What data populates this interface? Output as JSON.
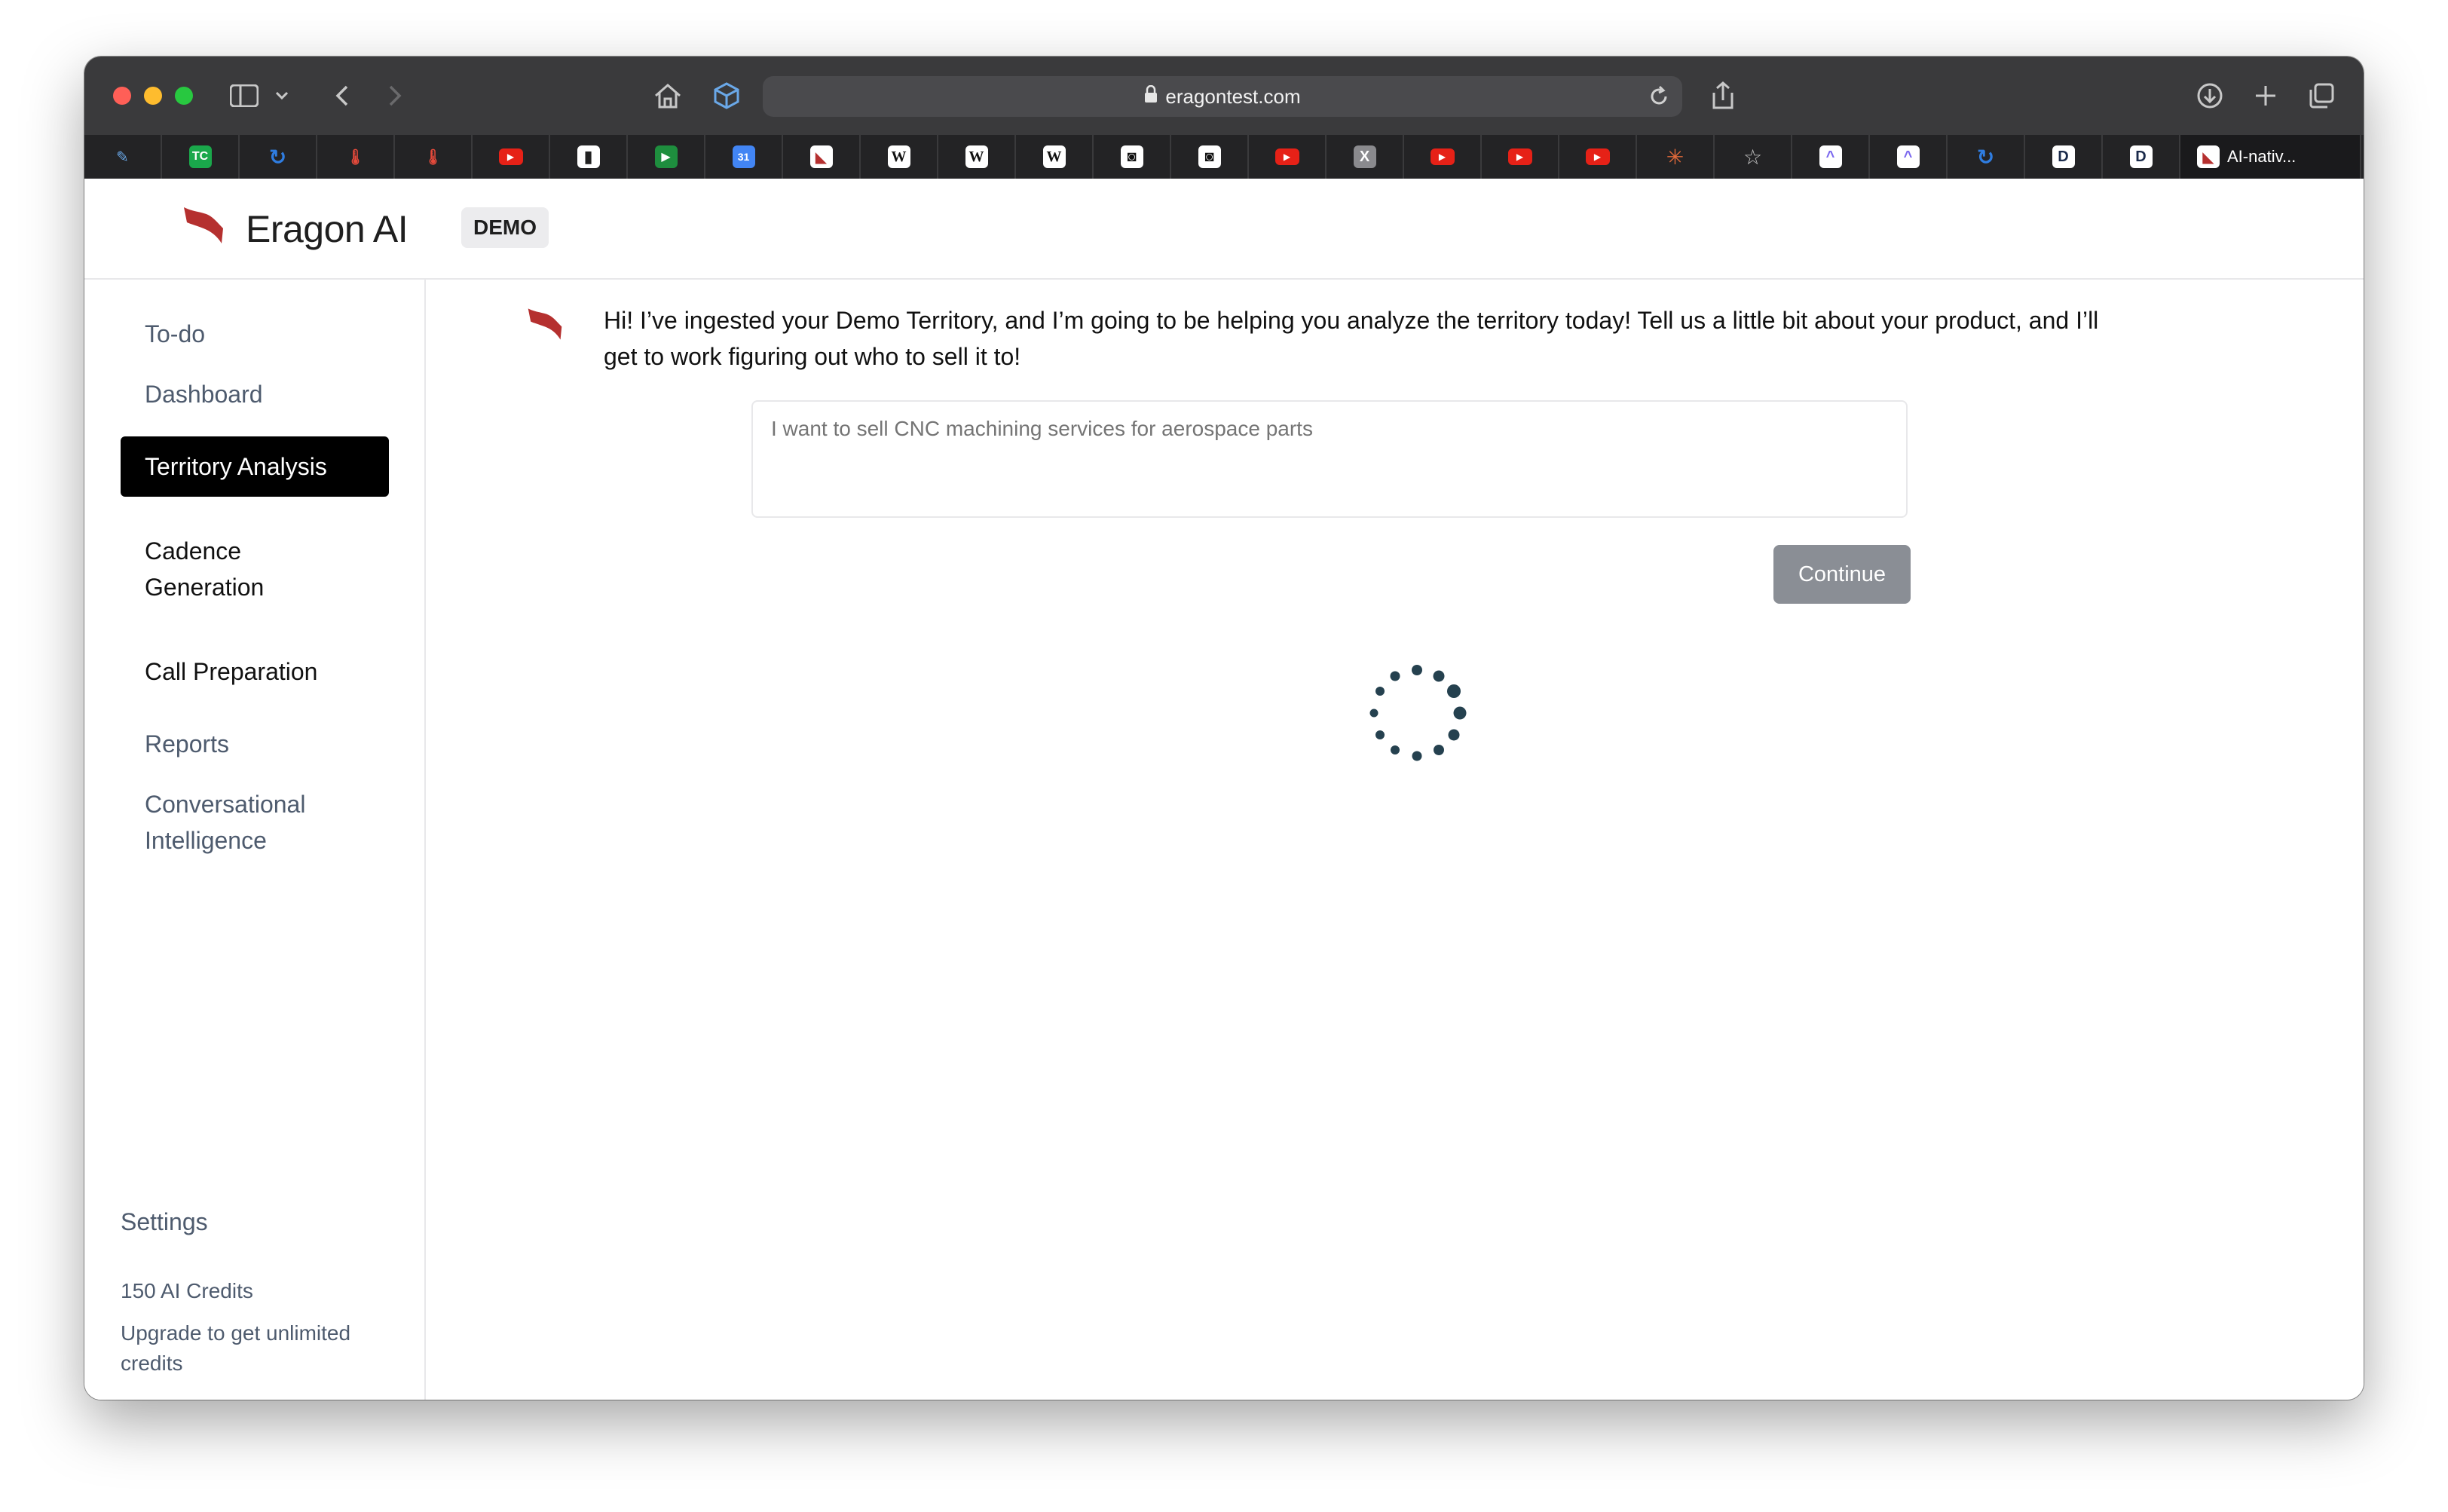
{
  "browser": {
    "url": "eragontest.com",
    "active_tab_title": "AI-nativ..."
  },
  "app": {
    "brand": "Eragon AI",
    "badge": "DEMO",
    "accent_color": "#b5302f"
  },
  "sidebar": {
    "items": [
      {
        "label": "To-do"
      },
      {
        "label": "Dashboard"
      },
      {
        "label": "Territory Analysis",
        "active": true
      },
      {
        "label": "Cadence Generation"
      },
      {
        "label": "Call Preparation"
      },
      {
        "label": "Reports"
      },
      {
        "label": "Conversational Intelligence"
      }
    ],
    "settings_label": "Settings",
    "credits": "150 AI Credits",
    "upgrade": "Upgrade to get unlimited credits"
  },
  "main": {
    "message": "Hi! I’ve ingested your Demo Territory, and I’m going to be helping you analyze the territory today! Tell us a little bit about your product, and I’ll get to work figuring out who to sell it to!",
    "input_placeholder": "I want to sell CNC machining services for aerospace parts",
    "continue_label": "Continue"
  }
}
